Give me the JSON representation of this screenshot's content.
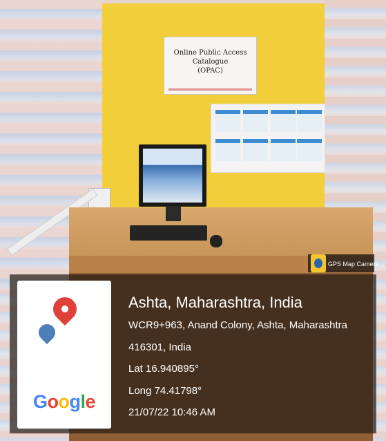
{
  "photo": {
    "sign_title_line1": "Online Public Access Catalogue",
    "sign_title_line2": "(OPAC)"
  },
  "overlay": {
    "place": "Ashta, Maharashtra, India",
    "address_line1": "WCR9+963, Anand Colony, Ashta, Maharashtra",
    "address_line2": "416301, India",
    "latitude": "Lat 16.940895°",
    "longitude": "Long 74.41798°",
    "datetime": "21/07/22 10:46 AM",
    "brand": "Google",
    "app_badge": "GPS Map Camera",
    "colors": {
      "google_blue": "#4285F4",
      "google_red": "#EA4335",
      "google_yellow": "#FBBC05",
      "google_green": "#34A853"
    }
  }
}
